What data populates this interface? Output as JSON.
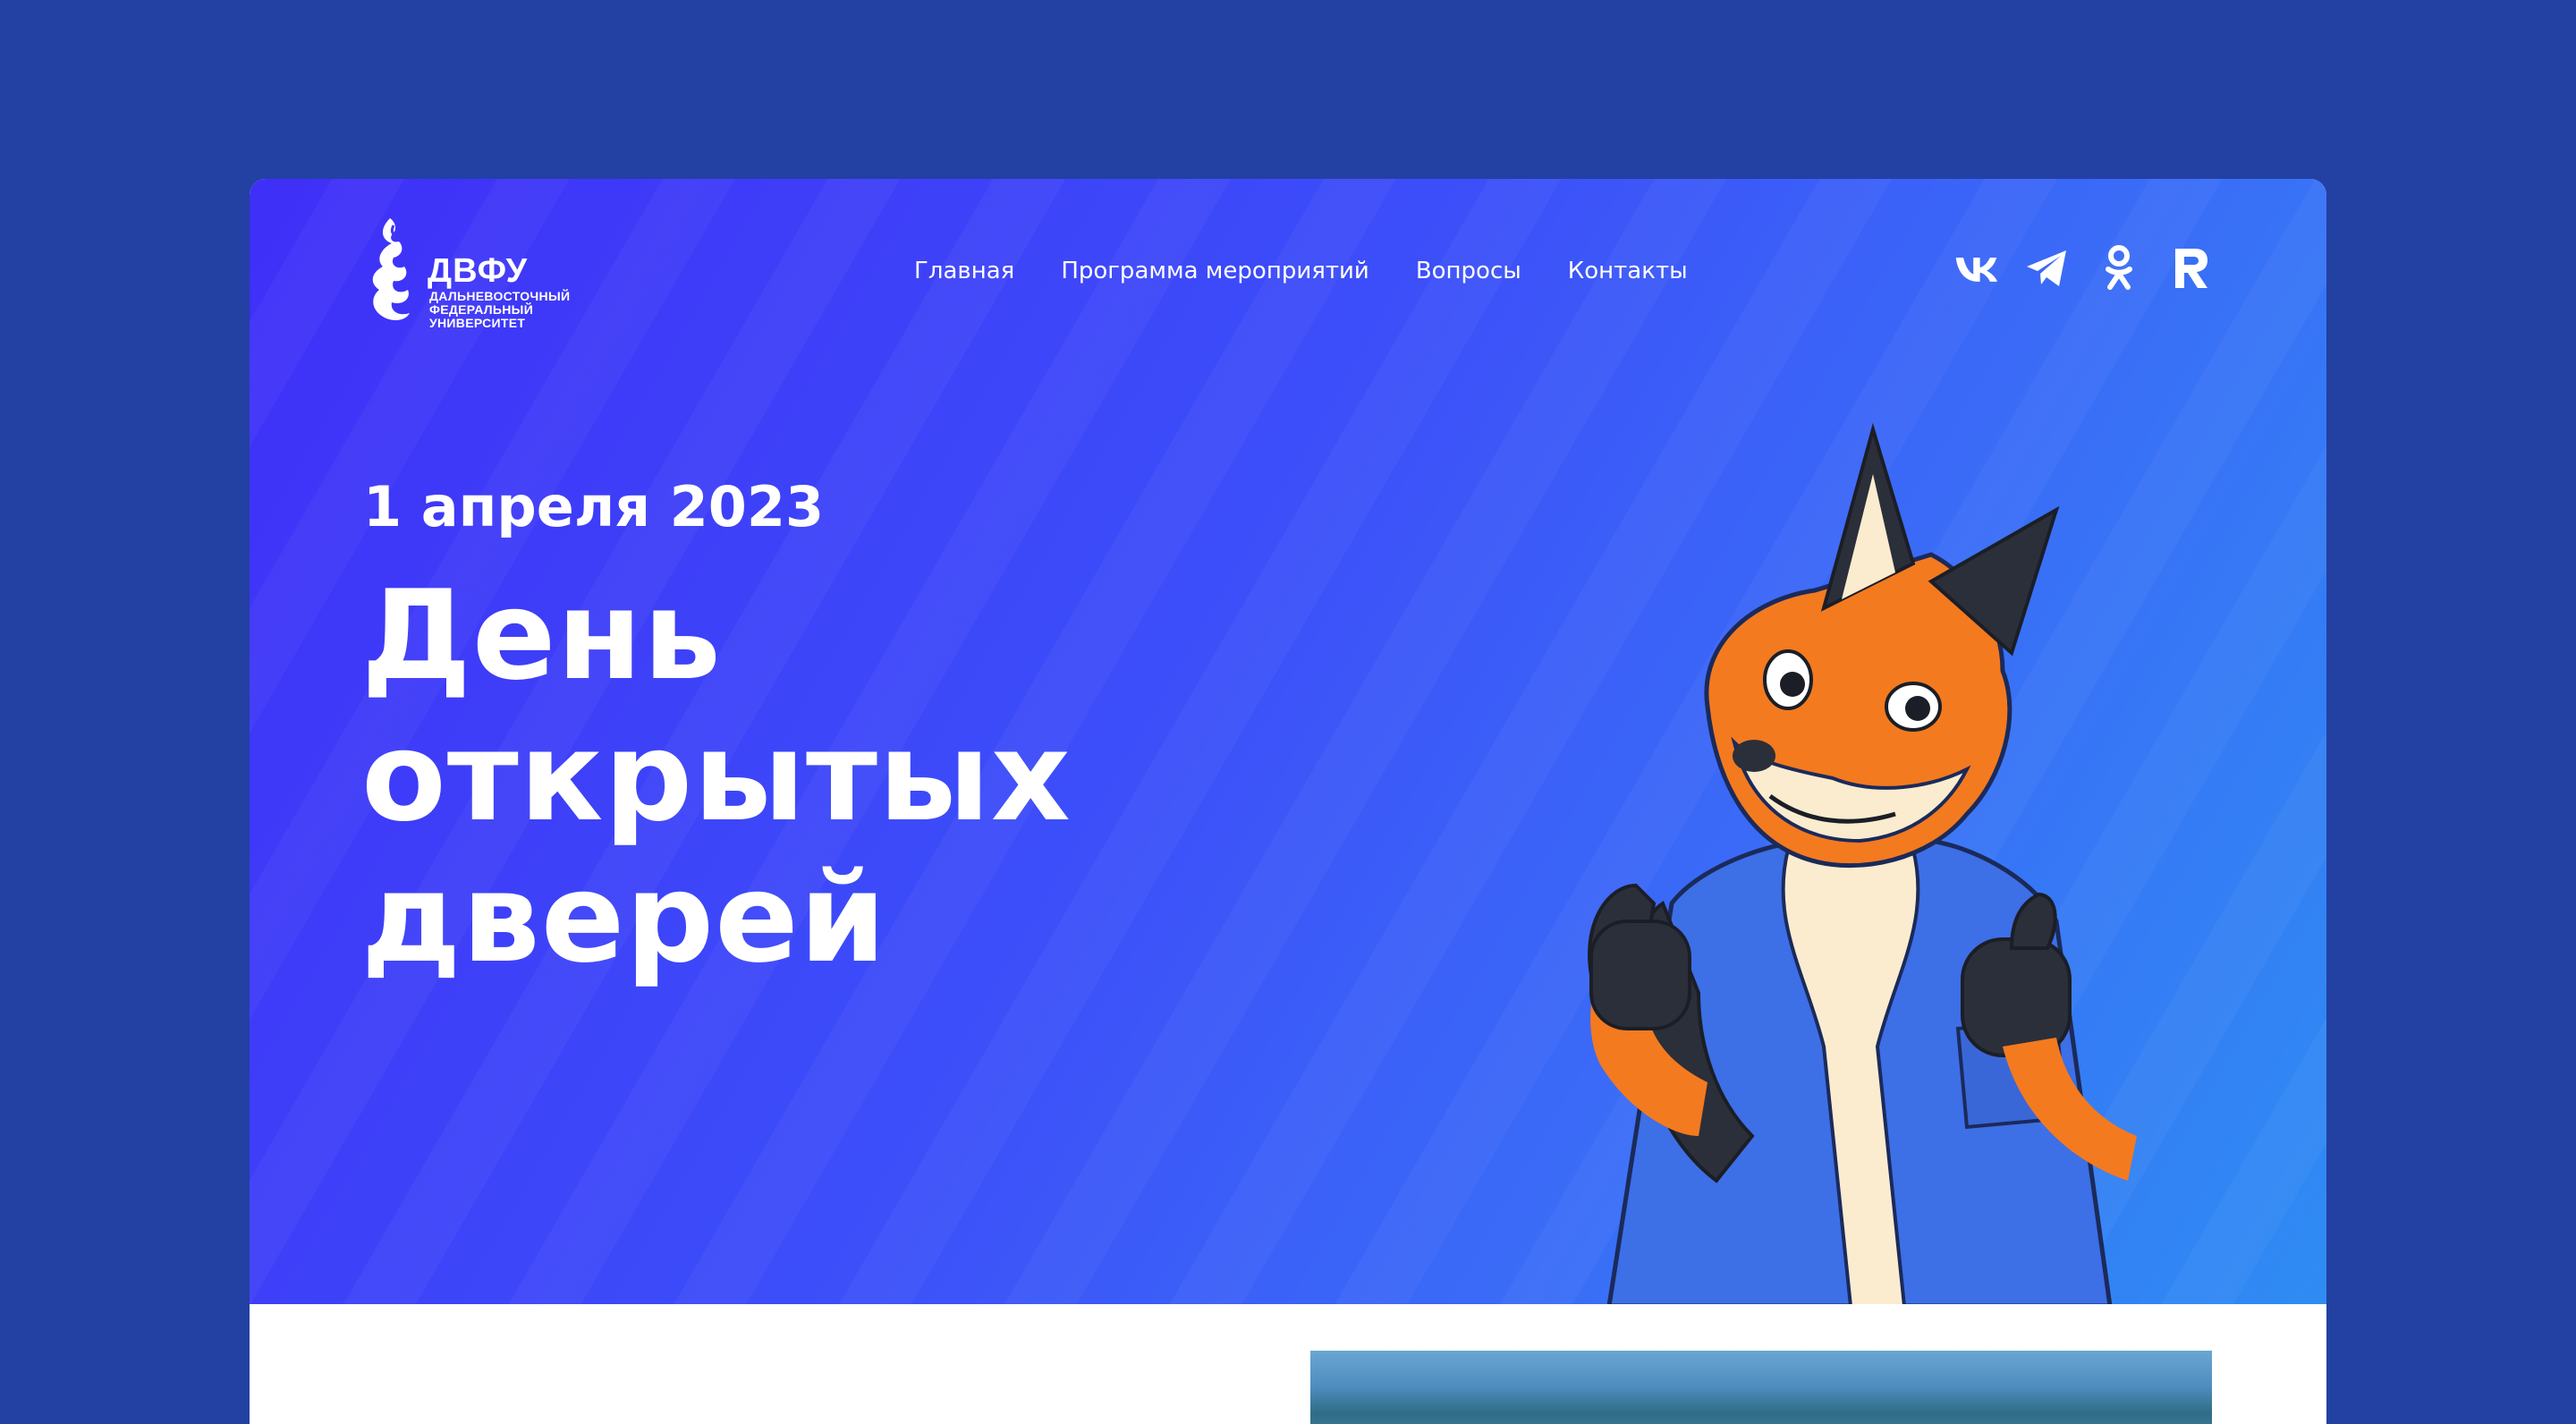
{
  "header": {
    "logo": {
      "title": "ДВФУ",
      "subtitle_lines": [
        "ДАЛЬНЕВОСТОЧНЫЙ",
        "ФЕДЕРАЛЬНЫЙ",
        "УНИВЕРСИТЕТ"
      ]
    },
    "nav": [
      "Главная",
      "Программа мероприятий",
      "Вопросы",
      "Контакты"
    ],
    "social": [
      "vk-icon",
      "telegram-icon",
      "odnoklassniki-icon",
      "rutube-icon"
    ]
  },
  "hero": {
    "date": "1 апреля 2023",
    "title_lines": [
      "День",
      "открытых",
      "дверей"
    ],
    "mascot": "fox-mascot-illustration"
  },
  "colors": {
    "page_background": "#2340a3",
    "hero_gradient_start": "#3f2ff8",
    "hero_gradient_end": "#2f8cf3",
    "text": "#ffffff"
  }
}
